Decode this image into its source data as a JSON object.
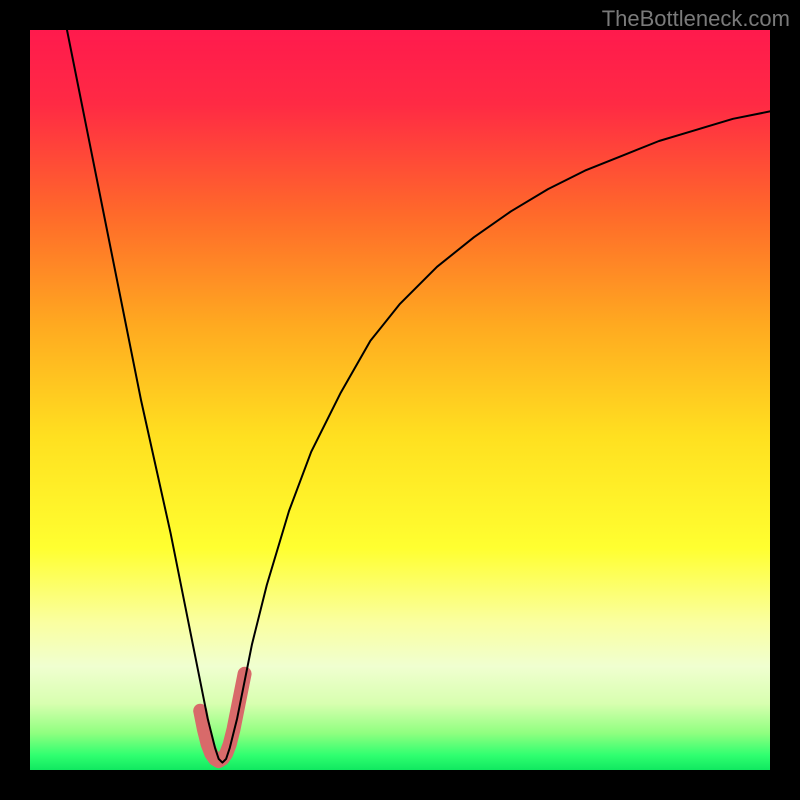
{
  "watermark": "TheBottleneck.com",
  "chart_data": {
    "type": "line",
    "title": "",
    "xlabel": "",
    "ylabel": "",
    "xlim": [
      0,
      100
    ],
    "ylim": [
      0,
      100
    ],
    "gradient_stops": [
      {
        "offset": 0.0,
        "color": "#ff1a4d"
      },
      {
        "offset": 0.1,
        "color": "#ff2a44"
      },
      {
        "offset": 0.25,
        "color": "#ff6a2a"
      },
      {
        "offset": 0.4,
        "color": "#ffaa20"
      },
      {
        "offset": 0.55,
        "color": "#ffe020"
      },
      {
        "offset": 0.7,
        "color": "#ffff30"
      },
      {
        "offset": 0.8,
        "color": "#faffa0"
      },
      {
        "offset": 0.86,
        "color": "#f0ffd0"
      },
      {
        "offset": 0.91,
        "color": "#d8ffb0"
      },
      {
        "offset": 0.95,
        "color": "#90ff80"
      },
      {
        "offset": 0.98,
        "color": "#30ff70"
      },
      {
        "offset": 1.0,
        "color": "#10e860"
      }
    ],
    "series": [
      {
        "name": "bottleneck-curve",
        "stroke": "#000000",
        "stroke_width": 2,
        "x": [
          5,
          7,
          9,
          11,
          13,
          15,
          17,
          19,
          21,
          22,
          23,
          24,
          25,
          25.5,
          26,
          26.5,
          27,
          28,
          29,
          30,
          32,
          35,
          38,
          42,
          46,
          50,
          55,
          60,
          65,
          70,
          75,
          80,
          85,
          90,
          95,
          100
        ],
        "y": [
          100,
          90,
          80,
          70,
          60,
          50,
          41,
          32,
          22,
          17,
          12,
          7,
          3,
          1.5,
          1,
          1.5,
          3,
          7,
          12,
          17,
          25,
          35,
          43,
          51,
          58,
          63,
          68,
          72,
          75.5,
          78.5,
          81,
          83,
          85,
          86.5,
          88,
          89
        ]
      }
    ],
    "highlight_segment": {
      "name": "valley-highlight",
      "stroke": "#d86a6a",
      "stroke_width": 14,
      "x": [
        23.0,
        23.5,
        24.0,
        24.5,
        25.0,
        25.5,
        26.0,
        26.5,
        27.0,
        27.5,
        28.0,
        28.5,
        29.0
      ],
      "y": [
        8.0,
        5.5,
        3.5,
        2.2,
        1.5,
        1.2,
        1.5,
        2.2,
        3.5,
        5.5,
        8.0,
        10.5,
        13.0
      ]
    }
  }
}
